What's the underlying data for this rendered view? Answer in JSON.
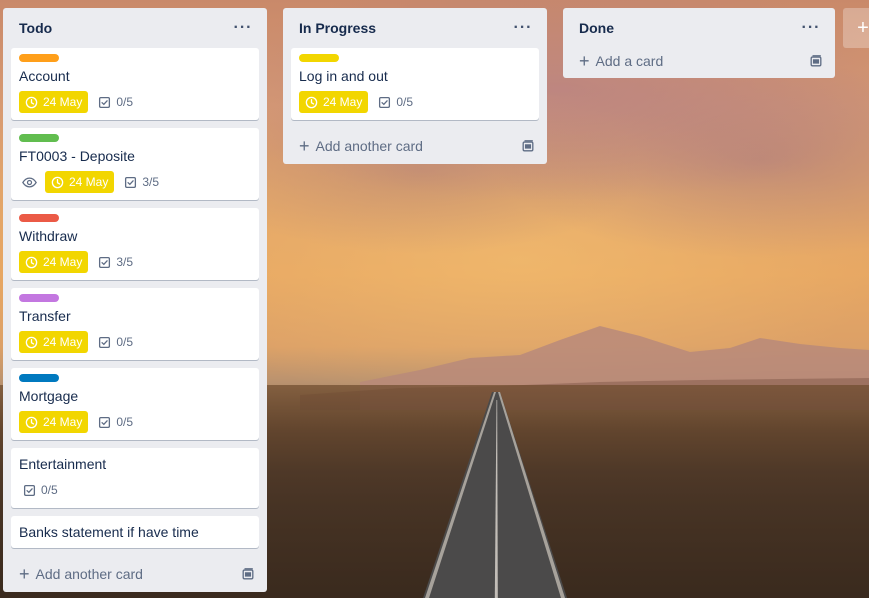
{
  "lists": [
    {
      "title": "Todo",
      "add_label": "Add another card",
      "cards": [
        {
          "title": "Account",
          "label_color": "#ff9f1a",
          "due": "24 May",
          "checklist": "0/5"
        },
        {
          "title": "FT0003 - Deposite",
          "label_color": "#61bd4f",
          "due": "24 May",
          "checklist": "3/5",
          "watching": true
        },
        {
          "title": "Withdraw",
          "label_color": "#eb5a46",
          "due": "24 May",
          "checklist": "3/5"
        },
        {
          "title": "Transfer",
          "label_color": "#c377e0",
          "due": "24 May",
          "checklist": "0/5"
        },
        {
          "title": "Mortgage",
          "label_color": "#0079bf",
          "due": "24 May",
          "checklist": "0/5"
        },
        {
          "title": "Entertainment",
          "checklist": "0/5"
        },
        {
          "title": "Banks statement if have time"
        }
      ]
    },
    {
      "title": "In Progress",
      "add_label": "Add another card",
      "cards": [
        {
          "title": "Log in and out",
          "label_color": "#f2d600",
          "due": "24 May",
          "checklist": "0/5"
        }
      ]
    },
    {
      "title": "Done",
      "add_label": "Add a card",
      "cards": []
    }
  ],
  "colors": {
    "due_badge": "#f2d600",
    "list_bg": "#ebecf0",
    "text": "#172b4d",
    "muted": "#5e6c84"
  },
  "icons": {
    "more": "more-horizontal-icon",
    "clock": "clock-icon",
    "checklist": "checklist-icon",
    "eye": "eye-icon",
    "plus": "plus-icon",
    "template": "card-template-icon"
  }
}
